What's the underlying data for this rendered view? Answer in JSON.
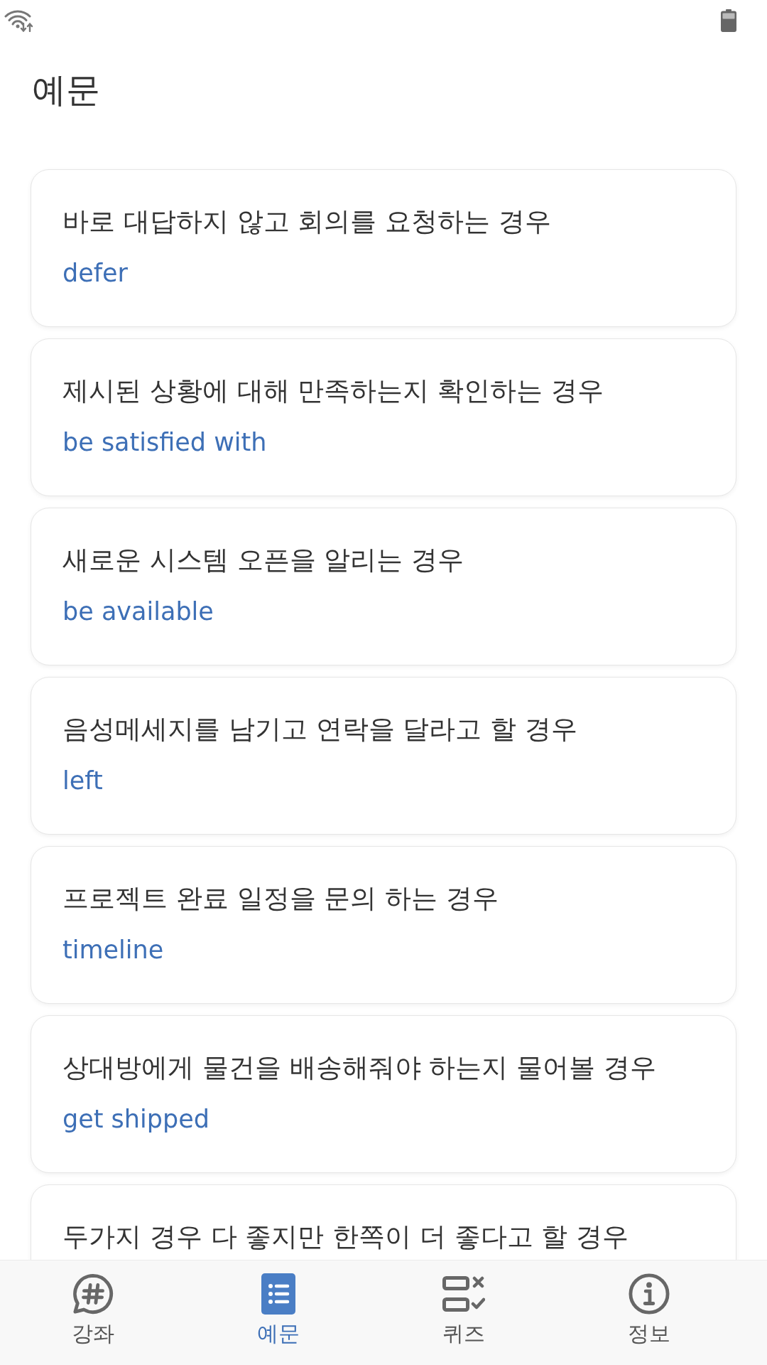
{
  "header": {
    "title": "예문"
  },
  "examples": [
    {
      "situation": "바로 대답하지 않고 회의를 요청하는 경우",
      "expression": "defer"
    },
    {
      "situation": "제시된 상황에 대해 만족하는지 확인하는 경우",
      "expression": "be satisfied with"
    },
    {
      "situation": "새로운 시스템 오픈을 알리는 경우",
      "expression": "be available"
    },
    {
      "situation": "음성메세지를 남기고 연락을 달라고 할 경우",
      "expression": "left"
    },
    {
      "situation": "프로젝트 완료 일정을 문의 하는 경우",
      "expression": "timeline"
    },
    {
      "situation": "상대방에게 물건을 배송해줘야 하는지 물어볼 경우",
      "expression": "get shipped"
    },
    {
      "situation": "두가지 경우 다 좋지만 한쪽이 더 좋다고 할 경우"
    }
  ],
  "nav": {
    "tabs": [
      {
        "label": "강좌",
        "selected": false
      },
      {
        "label": "예문",
        "selected": true
      },
      {
        "label": "퀴즈",
        "selected": false
      },
      {
        "label": "정보",
        "selected": false
      }
    ]
  }
}
